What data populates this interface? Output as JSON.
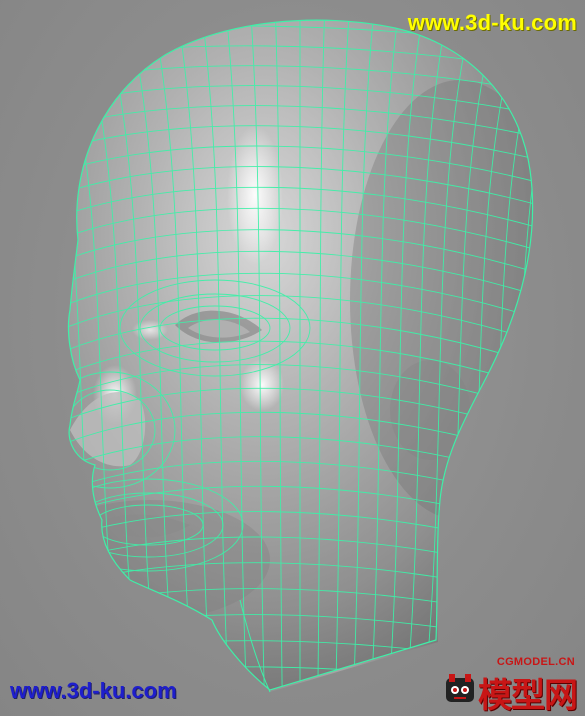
{
  "watermark": {
    "top_text": "www.3d-ku.com",
    "bottom_text": "www.3d-ku.com",
    "top_color": "#ffff00",
    "bottom_color": "#1e1ecc"
  },
  "logo": {
    "small_text": "CGMODEL.CN",
    "big_text": "模型网",
    "color": "#c81616"
  },
  "model": {
    "surface_color": "#a8a8a8",
    "wireframe_color": "#3ef0a8",
    "background_color": "#8d8d8d"
  }
}
